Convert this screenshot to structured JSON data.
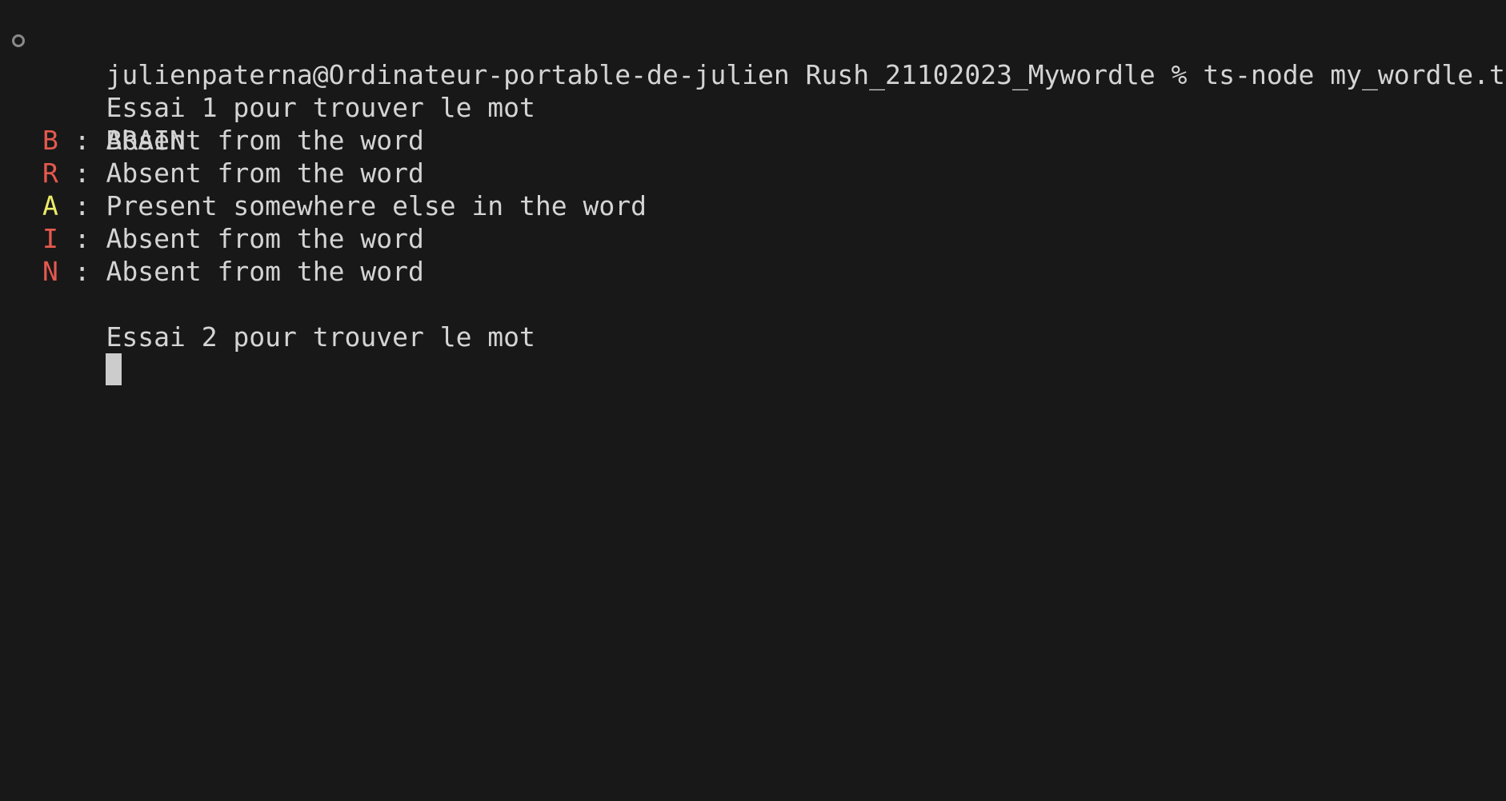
{
  "terminal": {
    "prompt": {
      "marker_icon": "circle-outline-icon",
      "text": "julienpaterna@Ordinateur-portable-de-julien Rush_21102023_Mywordle % ts-node my_wordle.ts"
    },
    "attempt_1_header": "Essai 1 pour trouver le mot",
    "guess": "BRAIN",
    "results": [
      {
        "letter": "B",
        "separator": " : ",
        "message": "Absent from the word",
        "status": "absent"
      },
      {
        "letter": "R",
        "separator": " : ",
        "message": "Absent from the word",
        "status": "absent"
      },
      {
        "letter": "A",
        "separator": " : ",
        "message": "Present somewhere else in the word",
        "status": "present"
      },
      {
        "letter": "I",
        "separator": " : ",
        "message": "Absent from the word",
        "status": "absent"
      },
      {
        "letter": "N",
        "separator": " : ",
        "message": "Absent from the word",
        "status": "absent"
      }
    ],
    "attempt_2_header": "Essai 2 pour trouver le mot",
    "colors": {
      "background": "#181818",
      "text": "#d4d4d4",
      "absent": "#e5594e",
      "present": "#ecec6a",
      "cursor": "#cccccc"
    }
  }
}
